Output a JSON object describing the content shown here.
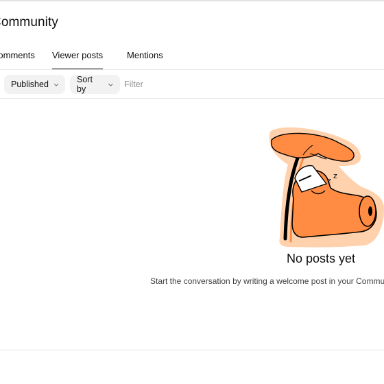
{
  "header": {
    "title": "Community"
  },
  "tabs": [
    {
      "label": "Comments"
    },
    {
      "label": "Viewer posts",
      "active": true
    },
    {
      "label": "Mentions"
    }
  ],
  "filters": {
    "published_label": "Published",
    "sort_label": "Sort by",
    "filter_placeholder": "Filter"
  },
  "empty_state": {
    "title": "No posts yet",
    "description": "Start the conversation by writing a welcome post in your Community"
  },
  "colors": {
    "accent_orange": "#ff8c42",
    "illustration_outline": "#000000"
  },
  "icons": [
    "chevron-down-icon",
    "sleeping-cat-illustration"
  ]
}
